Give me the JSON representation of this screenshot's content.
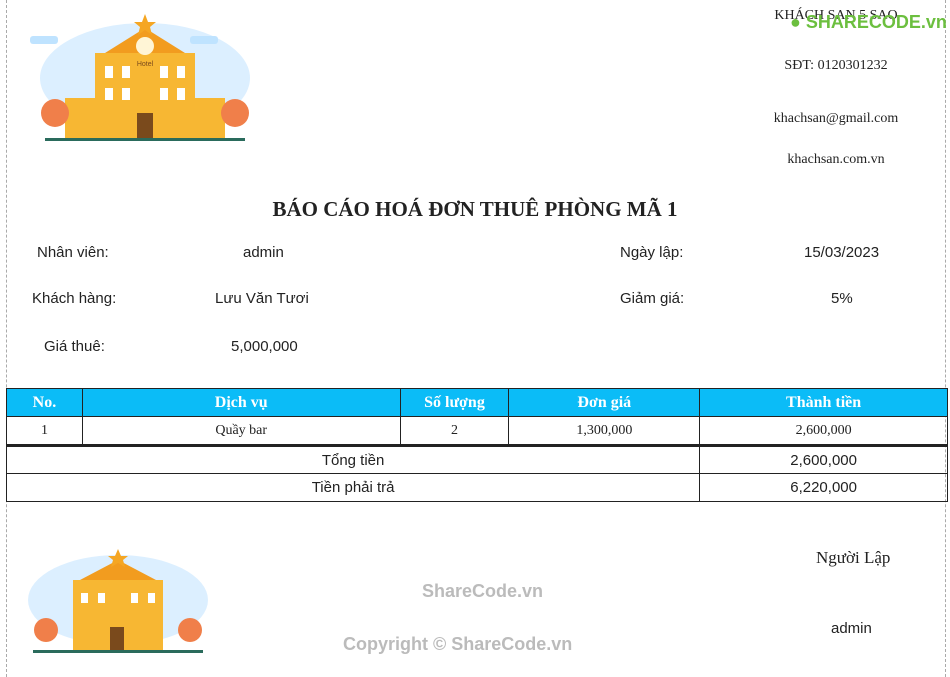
{
  "hotel": {
    "name": "KHÁCH SẠN 5 SAO",
    "phone": "SĐT: 0120301232",
    "email": "khachsan@gmail.com",
    "website": "khachsan.com.vn",
    "logo_text": "Hotel"
  },
  "title": "BÁO CÁO HOÁ ĐƠN THUÊ PHÒNG MÃ 1",
  "info": {
    "employee_label": "Nhân viên:",
    "employee": "admin",
    "date_label": "Ngày lập:",
    "date": "15/03/2023",
    "customer_label": "Khách hàng:",
    "customer": "Lưu Văn Tươi",
    "discount_label": "Giảm giá:",
    "discount": "5%",
    "price_label": "Giá thuê:",
    "price": "5,000,000"
  },
  "table": {
    "headers": [
      "No.",
      "Dịch vụ",
      "Số lượng",
      "Đơn giá",
      "Thành tiền"
    ],
    "rows": [
      [
        "1",
        "Quầy bar",
        "2",
        "1,300,000",
        "2,600,000"
      ]
    ],
    "total_label": "Tổng tiền",
    "total": "2,600,000",
    "pay_label": "Tiền phải trả",
    "pay": "6,220,000"
  },
  "footer": {
    "creator_label": "Người Lập",
    "creator": "admin"
  },
  "watermark": {
    "logo": "SHARECODE.vn",
    "center": "ShareCode.vn",
    "copyright": "Copyright © ShareCode.vn"
  },
  "colors": {
    "header_bg": "#0bbcf7"
  }
}
